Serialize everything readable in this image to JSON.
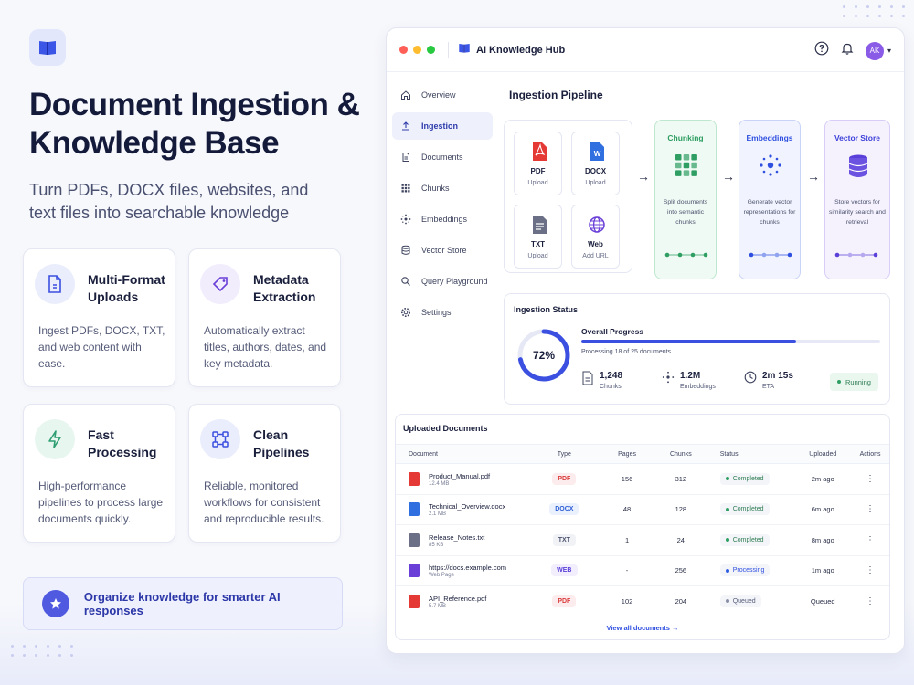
{
  "hero": {
    "title": "Document Ingestion & Knowledge Base",
    "subtitle": "Turn PDFs, DOCX files, websites, and text files into searchable knowledge"
  },
  "features": [
    {
      "title": "Multi-Format Uploads",
      "desc": "Ingest PDFs, DOCX, TXT, and web content with ease.",
      "icon": "file-icon"
    },
    {
      "title": "Metadata Extraction",
      "desc": "Automatically extract titles, authors, dates, and key metadata.",
      "icon": "tag-icon"
    },
    {
      "title": "Fast Processing",
      "desc": "High-performance pipelines to process large documents quickly.",
      "icon": "lightning-icon"
    },
    {
      "title": "Clean Pipelines",
      "desc": "Reliable, monitored workflows for consistent and reproducible results.",
      "icon": "pipeline-icon"
    }
  ],
  "cta": {
    "label": "Organize knowledge for smarter AI responses",
    "icon": "star-icon"
  },
  "app": {
    "title": "AI Knowledge Hub",
    "avatar": "AK"
  },
  "sidebar": {
    "items": [
      {
        "label": "Overview",
        "icon": "home-icon"
      },
      {
        "label": "Ingestion",
        "icon": "upload-icon",
        "active": true
      },
      {
        "label": "Documents",
        "icon": "document-icon"
      },
      {
        "label": "Chunks",
        "icon": "grid-icon"
      },
      {
        "label": "Embeddings",
        "icon": "embeddings-icon"
      },
      {
        "label": "Vector Store",
        "icon": "database-icon"
      },
      {
        "label": "Query Playground",
        "icon": "search-icon"
      },
      {
        "label": "Settings",
        "icon": "gear-icon"
      }
    ]
  },
  "pipeline": {
    "title": "Ingestion Pipeline",
    "sources": [
      {
        "label": "PDF",
        "sub": "Upload",
        "color": "#e53935"
      },
      {
        "label": "DOCX",
        "sub": "Upload",
        "color": "#2f6fe0"
      },
      {
        "label": "TXT",
        "sub": "Upload",
        "color": "#6b7086"
      },
      {
        "label": "Web",
        "sub": "Add URL",
        "color": "#6a3fd8"
      }
    ],
    "stages": [
      {
        "title": "Chunking",
        "desc": "Split documents into semantic chunks",
        "color": "#2e9e62",
        "bg": "#f0faf4",
        "border": "#bfe7cf"
      },
      {
        "title": "Embeddings",
        "desc": "Generate vector representations for chunks",
        "color": "#2f4fe0",
        "bg": "#f1f4fe",
        "border": "#c9d3f7"
      },
      {
        "title": "Vector Store",
        "desc": "Store vectors for similarity search and retrieval",
        "color": "#5a3fd8",
        "bg": "#f5f2fe",
        "border": "#d8cdf7"
      }
    ]
  },
  "status": {
    "title": "Ingestion Status",
    "percent_label": "72%",
    "percent": 0.72,
    "overall_label": "Overall Progress",
    "processing_text": "Processing 18 of 25 documents",
    "stats": [
      {
        "value": "1,248",
        "label": "Chunks",
        "icon": "document-icon"
      },
      {
        "value": "1.2M",
        "label": "Embeddings",
        "icon": "embeddings-icon"
      },
      {
        "value": "2m 15s",
        "label": "ETA",
        "icon": "clock-icon"
      }
    ],
    "running_label": "Running"
  },
  "documents": {
    "title": "Uploaded Documents",
    "headers": [
      "Document",
      "Type",
      "Pages",
      "Chunks",
      "Status",
      "Uploaded",
      "Actions"
    ],
    "rows": [
      {
        "name": "Product_Manual.pdf",
        "size": "12.4 MB",
        "type": "PDF",
        "pages": "156",
        "chunks": "312",
        "status": "Completed",
        "uploaded": "2m ago",
        "file_color": "#e53935"
      },
      {
        "name": "Technical_Overview.docx",
        "size": "2.1 MB",
        "type": "DOCX",
        "pages": "48",
        "chunks": "128",
        "status": "Completed",
        "uploaded": "6m ago",
        "file_color": "#2f6fe0"
      },
      {
        "name": "Release_Notes.txt",
        "size": "85 KB",
        "type": "TXT",
        "pages": "1",
        "chunks": "24",
        "status": "Completed",
        "uploaded": "8m ago",
        "file_color": "#6b7086"
      },
      {
        "name": "https://docs.example.com",
        "size": "Web Page",
        "type": "WEB",
        "pages": "-",
        "chunks": "256",
        "status": "Processing",
        "uploaded": "1m ago",
        "file_color": "#6a3fd8"
      },
      {
        "name": "API_Reference.pdf",
        "size": "5.7 MB",
        "type": "PDF",
        "pages": "102",
        "chunks": "204",
        "status": "Queued",
        "uploaded": "Queued",
        "file_color": "#e53935"
      }
    ],
    "view_all": "View all documents →"
  },
  "colors": {
    "accent": "#3b4fe0",
    "completed": "#2e9e62",
    "processing": "#2f5fe0",
    "queued": "#8a8fa6"
  }
}
